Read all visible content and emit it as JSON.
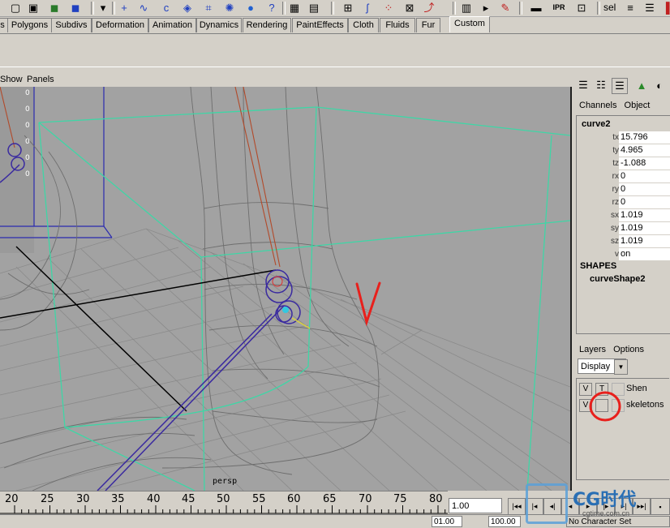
{
  "shelf_tabs": [
    "s",
    "Polygons",
    "Subdivs",
    "Deformation",
    "Animation",
    "Dynamics",
    "Rendering",
    "PaintEffects",
    "Cloth",
    "Fluids",
    "Fur",
    "Custom"
  ],
  "active_shelf_tab": "Custom",
  "toolbar": {
    "icons": [
      "select-tool-icon",
      "move-tool-icon",
      "scale-tool-icon",
      "menu-arrow-icon",
      "cross-icon",
      "curve-tool-icon",
      "arc-tool-icon",
      "cube-icon",
      "lattice-icon",
      "cluster-icon",
      "sphere-icon",
      "help-icon",
      "render-icon",
      "render-region-icon",
      "snap-grid-icon",
      "snap-curve-icon",
      "snap-point-icon",
      "snap-view-icon",
      "history-icon",
      "ipr-icon",
      "render-globals-icon",
      "paint-icon",
      "channel-box-toggle-icon"
    ],
    "render_label": "IPR",
    "sel_label": "sel"
  },
  "viewport": {
    "menu": [
      "Show",
      "Panels"
    ],
    "camera": "persp",
    "strip_numbers": [
      "0",
      "0",
      "0",
      "0",
      "0",
      "0"
    ]
  },
  "channel_box": {
    "menu": [
      "Channels",
      "Object"
    ],
    "object_name": "curve2",
    "channels": [
      {
        "name": "tx",
        "value": "15.796"
      },
      {
        "name": "ty",
        "value": "4.965"
      },
      {
        "name": "tz",
        "value": "-1.088"
      },
      {
        "name": "rx",
        "value": "0"
      },
      {
        "name": "ry",
        "value": "0"
      },
      {
        "name": "rz",
        "value": "0"
      },
      {
        "name": "sx",
        "value": "1.019"
      },
      {
        "name": "sy",
        "value": "1.019"
      },
      {
        "name": "sz",
        "value": "1.019"
      },
      {
        "name": "v",
        "value": "on"
      }
    ],
    "shapes_label": "SHAPES",
    "shape_name": "curveShape2"
  },
  "layers": {
    "menu": [
      "Layers",
      "Options"
    ],
    "display_value": "Display",
    "items": [
      {
        "v": "V",
        "t": "T",
        "name": "Shen"
      },
      {
        "v": "V",
        "t": "",
        "name": "skeletons"
      }
    ]
  },
  "timeline": {
    "ticks": [
      "20",
      "25",
      "30",
      "35",
      "40",
      "45",
      "50",
      "55",
      "60",
      "65",
      "70",
      "75",
      "80"
    ],
    "current_frame": "1.00",
    "range_start": "01.00",
    "range_end": "100.00",
    "character_set": "No Character Set"
  },
  "annotations": {
    "mark_color": "#e8201c"
  },
  "watermark": {
    "brand": "CG时代",
    "site": "cgtime.com.cn"
  }
}
